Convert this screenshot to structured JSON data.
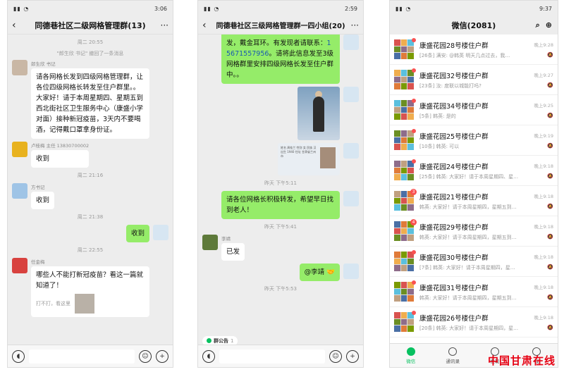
{
  "phone1": {
    "status_time": "3:06",
    "title": "同德巷社区二级网格管理群(13)",
    "messages": {
      "t1": "周二 20:55",
      "recall": "\"郎生欣 书记\" 撤回了一条消息",
      "m1_sender": "郎生欣 书记",
      "m1_text": "请各网格长发到四级网格管理群，让各位四级网格长转发至住户群里。。大家好！请于本周星期四、星期五到西北街社区卫生服务中心（康盛小学对面）接种新冠疫苗，3天内不要喝酒，记得戴口罩拿身份证。",
      "m2_sender": "卢桂梅 主任 13830700002",
      "m2_text": "收到",
      "t2": "周二 21:16",
      "m3_sender": "方书记",
      "m3_text": "收到",
      "t3": "周二 21:38",
      "m4_text": "收到",
      "t4": "周二 22:55",
      "m5_sender": "任金梅",
      "m5_text": "哪些人不能打新冠疫苗？看这一篇就知道了！",
      "m5_sub": "打不打，看这里"
    }
  },
  "phone2": {
    "status_time": "2:59",
    "title": "同德巷社区三级网格管理群一四小组(20)",
    "messages": {
      "m1_pre": "发，戴金耳环。有发现者请联系：",
      "m1_phone": "15671557956",
      "m1_post": "。请将此信息发至3级网格群里安排四级网格长发至住户群中。。",
      "id_text": "姓名 周桂兰 性别 女 民族 汉 出生 1940 住址 甘肃省兰州市",
      "t1": "昨天 下午5:11",
      "m2_text": "请各位网格长积极转发，希望早日找到老人！",
      "t2": "昨天 下午5:41",
      "m3_sender": "李靖",
      "m3_text": "已发",
      "m4_text": "@李靖 🤝",
      "t3": "昨天 下午5:53",
      "notice": "群公告",
      "notice_count": "1"
    }
  },
  "phone3": {
    "status_time": "9:37",
    "title": "微信(2081)",
    "chats": [
      {
        "name": "康盛花园28号楼住户群",
        "preview": "[26条] 满安: @韩英 明天几点过去，我…",
        "time": "晚上9:28",
        "badge": ""
      },
      {
        "name": "康盛花园32号楼住户群",
        "preview": "[23条] 汝: 度联以城能打吗?",
        "time": "晚上9:27",
        "badge": ""
      },
      {
        "name": "康盛花园34号楼住户群",
        "preview": "[5条] 韩英: 是的",
        "time": "晚上9:25",
        "badge": ""
      },
      {
        "name": "康盛花园25号楼住户群",
        "preview": "[10条] 韩英: 可以",
        "time": "晚上9:19",
        "badge": ""
      },
      {
        "name": "康盛花园24号楼住户群",
        "preview": "[25条] 韩英: 大家好！请于本周星期四、星…",
        "time": "晚上9:18",
        "badge": ""
      },
      {
        "name": "康盛花园21号楼住户群",
        "preview": "韩英: 大家好！请于本周星期四，星期五到…",
        "time": "晚上9:18",
        "badge": "3"
      },
      {
        "name": "康盛花园29号楼住户群",
        "preview": "韩英: 大家好！请于本周星期四，星期五到…",
        "time": "晚上9:18",
        "badge": "4"
      },
      {
        "name": "康盛花园30号楼住户群",
        "preview": "[7条] 韩英: 大家好！请于本周星期四，星…",
        "time": "晚上9:18",
        "badge": ""
      },
      {
        "name": "康盛花园31号楼住户群",
        "preview": "韩英: 大家好！请于本周星期四，星期五到…",
        "time": "晚上9:18",
        "badge": ""
      },
      {
        "name": "康盛花园26号楼住户群",
        "preview": "[20条] 韩英: 大家好！请于本周星期四，星…",
        "time": "晚上9:18",
        "badge": ""
      }
    ],
    "tabs": [
      "微信",
      "通讯录",
      "发现",
      "我"
    ]
  },
  "watermark": "中国甘肃在线"
}
